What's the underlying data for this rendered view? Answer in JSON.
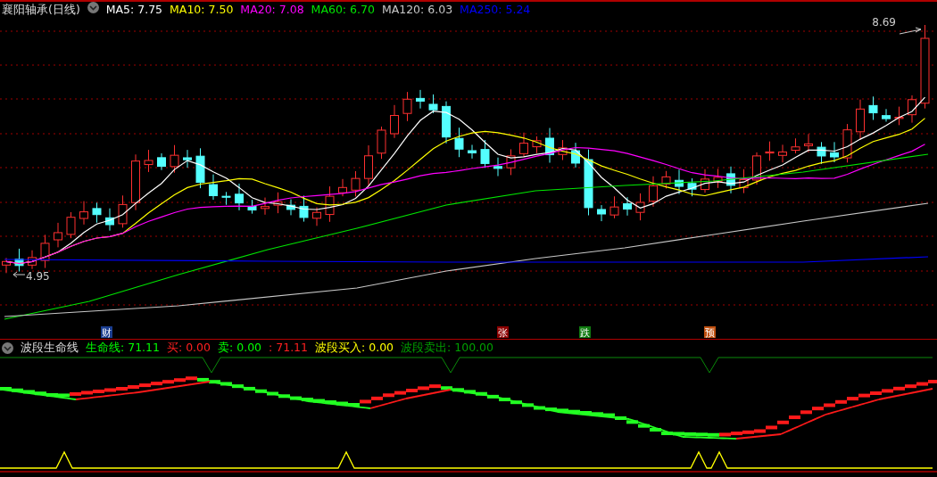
{
  "main_chart": {
    "title": "襄阳轴承(日线)",
    "ma_legend": [
      {
        "text": "MA5: 7.75",
        "color": "#ffffff"
      },
      {
        "text": "MA10: 7.50",
        "color": "#ffff00"
      },
      {
        "text": "MA20: 7.08",
        "color": "#ff00ff"
      },
      {
        "text": "MA60: 6.70",
        "color": "#00e600"
      },
      {
        "text": "MA120: 6.03",
        "color": "#c8c8c8"
      },
      {
        "text": "MA250: 5.24",
        "color": "#0000ff"
      }
    ],
    "high_label": "8.69",
    "low_label": "4.95",
    "markers": [
      {
        "text": "财",
        "color": "#1a3d8f"
      },
      {
        "text": "张",
        "color": "#8b0000"
      },
      {
        "text": "跌",
        "color": "#107a10"
      },
      {
        "text": "预",
        "color": "#c05010"
      }
    ]
  },
  "indicator": {
    "title": "波段生命线",
    "legend": [
      {
        "text": "生命线: 71.11",
        "color": "#00ff00"
      },
      {
        "text": "买: 0.00",
        "color": "#ff2020"
      },
      {
        "text": "卖: 0.00",
        "color": "#00ff00"
      },
      {
        "text": ": 71.11",
        "color": "#ff2020"
      },
      {
        "text": "波段买入: 0.00",
        "color": "#ffff00"
      },
      {
        "text": "波段卖出: 100.00",
        "color": "#00a000"
      }
    ]
  }
}
